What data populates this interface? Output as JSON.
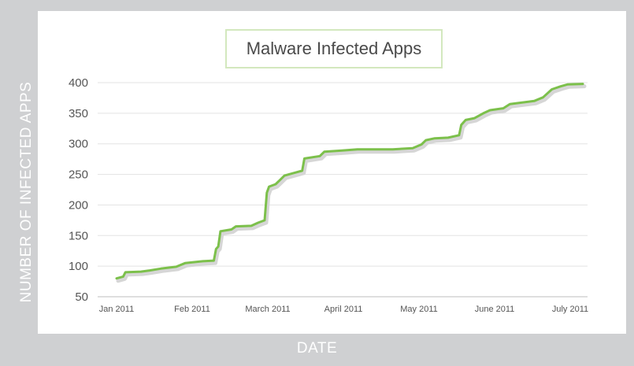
{
  "chart_data": {
    "type": "line",
    "title": "Malware Infected Apps",
    "xlabel": "DATE",
    "ylabel": "NUMBER OF INFECTED APPS",
    "ylim": [
      50,
      400
    ],
    "yticks": [
      50,
      100,
      150,
      200,
      250,
      300,
      350,
      400
    ],
    "xticks": [
      "Jan 2011",
      "Feb 2011",
      "March 2011",
      "April 2011",
      "May 2011",
      "June 2011",
      "July 2011"
    ],
    "xlim": [
      "2011-01-01",
      "2011-07-31"
    ],
    "grid": true,
    "series": [
      {
        "color": "#7cc04b",
        "shadow_color": "#d6d6d6",
        "points": [
          [
            "2011-01-01",
            80
          ],
          [
            "2011-01-04",
            83
          ],
          [
            "2011-01-05",
            90
          ],
          [
            "2011-01-12",
            91
          ],
          [
            "2011-01-16",
            93
          ],
          [
            "2011-01-21",
            96
          ],
          [
            "2011-01-28",
            99
          ],
          [
            "2011-02-01",
            105
          ],
          [
            "2011-02-09",
            108
          ],
          [
            "2011-02-14",
            109
          ],
          [
            "2011-02-15",
            128
          ],
          [
            "2011-02-16",
            132
          ],
          [
            "2011-02-17",
            157
          ],
          [
            "2011-02-22",
            160
          ],
          [
            "2011-02-24",
            165
          ],
          [
            "2011-03-03",
            166
          ],
          [
            "2011-03-06",
            171
          ],
          [
            "2011-03-09",
            175
          ],
          [
            "2011-03-10",
            220
          ],
          [
            "2011-03-11",
            230
          ],
          [
            "2011-03-14",
            234
          ],
          [
            "2011-03-16",
            241
          ],
          [
            "2011-03-18",
            248
          ],
          [
            "2011-03-23",
            253
          ],
          [
            "2011-03-26",
            256
          ],
          [
            "2011-03-27",
            276
          ],
          [
            "2011-04-03",
            280
          ],
          [
            "2011-04-05",
            287
          ],
          [
            "2011-04-13",
            289
          ],
          [
            "2011-04-20",
            291
          ],
          [
            "2011-05-06",
            291
          ],
          [
            "2011-05-15",
            293
          ],
          [
            "2011-05-19",
            299
          ],
          [
            "2011-05-21",
            306
          ],
          [
            "2011-05-25",
            309
          ],
          [
            "2011-05-31",
            310
          ],
          [
            "2011-06-05",
            314
          ],
          [
            "2011-06-06",
            331
          ],
          [
            "2011-06-08",
            339
          ],
          [
            "2011-06-12",
            342
          ],
          [
            "2011-06-16",
            350
          ],
          [
            "2011-06-19",
            355
          ],
          [
            "2011-06-25",
            358
          ],
          [
            "2011-06-28",
            365
          ],
          [
            "2011-07-09",
            370
          ],
          [
            "2011-07-13",
            376
          ],
          [
            "2011-07-17",
            389
          ],
          [
            "2011-07-21",
            394
          ],
          [
            "2011-07-24",
            397
          ],
          [
            "2011-07-31",
            398
          ]
        ]
      }
    ]
  }
}
